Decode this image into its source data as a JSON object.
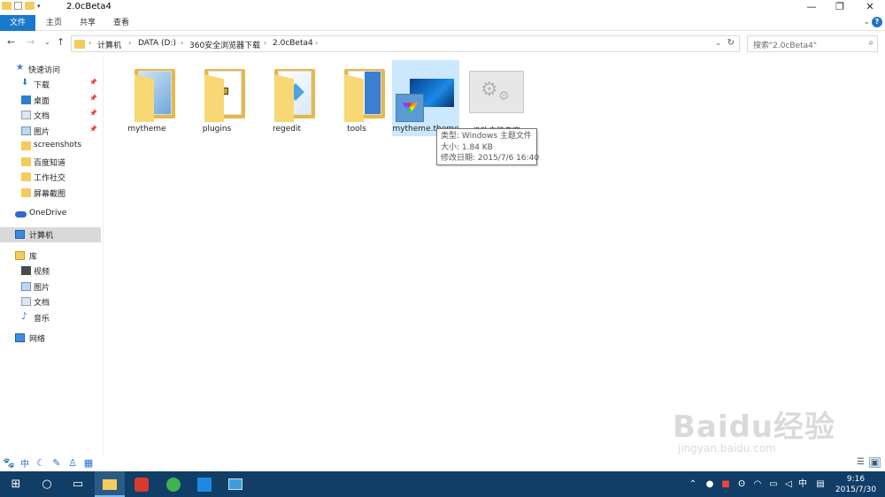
{
  "window": {
    "title": "2.0cBeta4",
    "minimize_glyph": "—",
    "restore_glyph": "❐",
    "close_glyph": "✕"
  },
  "ribbon": {
    "tabs": [
      "文件",
      "主页",
      "共享",
      "查看"
    ]
  },
  "address": {
    "crumbs": [
      "计算机",
      "DATA (D:)",
      "360安全浏览器下载",
      "2.0cBeta4"
    ]
  },
  "search": {
    "placeholder": "搜索\"2.0cBeta4\""
  },
  "sidebar": {
    "quick_access": "快速访问",
    "quick_items": [
      "下载",
      "桌面",
      "文档",
      "图片",
      "screenshots",
      "百度知道",
      "工作社交",
      "屏幕截图"
    ],
    "onedrive": "OneDrive",
    "computer": "计算机",
    "library": "库",
    "library_items": [
      "视频",
      "图片",
      "文档",
      "音乐"
    ],
    "network": "网络"
  },
  "content": {
    "items": [
      {
        "name": "mytheme",
        "type": "folder"
      },
      {
        "name": "plugins",
        "type": "folder"
      },
      {
        "name": "regedit",
        "type": "folder"
      },
      {
        "name": "tools",
        "type": "folder"
      },
      {
        "name": "mytheme.theme",
        "type": "theme-file"
      },
      {
        "name": "极致电脑专家",
        "type": "settings-file"
      }
    ]
  },
  "tooltip": {
    "type": "类型: Windows 主题文件",
    "size": "大小: 1.84 KB",
    "modified": "修改日期: 2015/7/6 16:40"
  },
  "taskbar": {
    "ime": "中",
    "time": "9:16",
    "date": "2015/7/30"
  },
  "watermark": {
    "main": "Baidu经验",
    "sub": "jingyan.baidu.com"
  },
  "colors": {
    "accent": "#1979ca",
    "taskbar": "#103e66",
    "selection": "#cce8ff",
    "folder": "#f4cc5c"
  }
}
